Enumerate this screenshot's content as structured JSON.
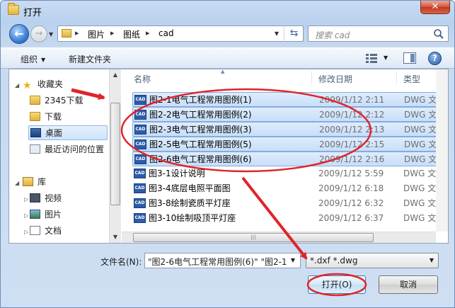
{
  "window": {
    "title": "打开",
    "close_icon": "close-icon"
  },
  "address": {
    "segments": [
      "图片",
      "图纸",
      "cad"
    ]
  },
  "search": {
    "placeholder": "搜索 cad"
  },
  "toolbar": {
    "organize": "组织",
    "new_folder": "新建文件夹"
  },
  "nav": {
    "favorites": "收藏夹",
    "fav_items": [
      "2345下载",
      "下载",
      "桌面",
      "最近访问的位置"
    ],
    "library": "库",
    "lib_items": [
      "视频",
      "图片",
      "文档"
    ]
  },
  "columns": {
    "name": "名称",
    "date": "修改日期",
    "type": "类型"
  },
  "files": [
    {
      "name": "图2-1电气工程常用图例(1)",
      "date": "2009/1/12 2:11",
      "type": "DWG 文件",
      "selected": true
    },
    {
      "name": "图2-2电气工程常用图例(2)",
      "date": "2009/1/12 2:12",
      "type": "DWG 文件",
      "selected": true
    },
    {
      "name": "图2-3电气工程常用图例(3)",
      "date": "2009/1/12 2:13",
      "type": "DWG 文件",
      "selected": true
    },
    {
      "name": "图2-5电气工程常用图例(5)",
      "date": "2009/1/12 2:15",
      "type": "DWG 文件",
      "selected": true
    },
    {
      "name": "图2-6电气工程常用图例(6)",
      "date": "2009/1/12 2:16",
      "type": "DWG 文件",
      "selected": true
    },
    {
      "name": "图3-1设计说明",
      "date": "2009/1/12 5:59",
      "type": "DWG 文件",
      "selected": false
    },
    {
      "name": "图3-4底层电照平面图",
      "date": "2009/1/12 6:18",
      "type": "DWG 文件",
      "selected": false
    },
    {
      "name": "图3-8绘制瓷质平灯座",
      "date": "2009/1/12 6:32",
      "type": "DWG 文件",
      "selected": false
    },
    {
      "name": "图3-10绘制吸顶平灯座",
      "date": "2009/1/12 6:37",
      "type": "DWG 文件",
      "selected": false
    }
  ],
  "filename": {
    "label": "文件名(N):",
    "value": "\"图2-6电气工程常用图例(6)\" \"图2-1"
  },
  "filetype": {
    "value": "*.dxf *.dwg"
  },
  "buttons": {
    "open": "打开(O)",
    "cancel": "取消"
  },
  "icon_label": "CAD",
  "annotation_color": "#e0242a"
}
